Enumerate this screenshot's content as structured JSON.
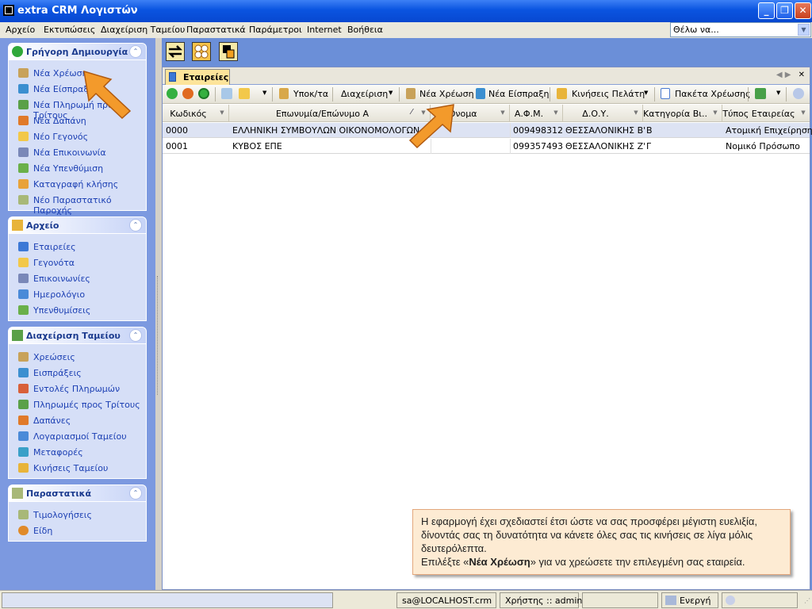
{
  "window": {
    "title": "extra CRM Λογιστών"
  },
  "menu": [
    "Αρχείο",
    "Εκτυπώσεις",
    "Διαχείριση Ταμείου",
    "Παραστατικά",
    "Παράμετροι",
    "Internet",
    "Βοήθεια"
  ],
  "search": {
    "value": "Θέλω να..."
  },
  "sidebar": {
    "quick": {
      "title": "Γρήγορη Δημιουργία",
      "items": [
        "Νέα Χρέωση",
        "Νέα Είσπραξη",
        "Νέα Πληρωμή προς Τρίτους",
        "Νέα Δαπάνη",
        "Νέο Γεγονός",
        "Νέα Επικοινωνία",
        "Νέα Υπενθύμιση",
        "Καταγραφή κλήσης",
        "Νέο Παραστατικό Παροχής"
      ]
    },
    "archive": {
      "title": "Αρχείο",
      "items": [
        "Εταιρείες",
        "Γεγονότα",
        "Επικοινωνίες",
        "Ημερολόγιο",
        "Υπενθυμίσεις"
      ]
    },
    "cash": {
      "title": "Διαχείριση Ταμείου",
      "items": [
        "Χρεώσεις",
        "Εισπράξεις",
        "Εντολές Πληρωμών",
        "Πληρωμές προς Τρίτους",
        "Δαπάνες",
        "Λογαριασμοί Ταμείου",
        "Μεταφορές",
        "Κινήσεις Ταμείου"
      ]
    },
    "docs": {
      "title": "Παραστατικά",
      "items": [
        "Τιμολογήσεις",
        "Είδη"
      ]
    }
  },
  "tab": {
    "label": "Εταιρείες"
  },
  "toolbar": {
    "subcat": "Υποκ/τα",
    "manage": "Διαχείριση",
    "new_charge": "Νέα Χρέωση",
    "new_receipt": "Νέα Είσπραξη",
    "moves": "Κινήσεις Πελάτη",
    "packages": "Πακέτα Χρέωσης"
  },
  "grid": {
    "columns": [
      "Κωδικός",
      "Επωνυμία/Επώνυμο Α",
      "Όνομα",
      "Α.Φ.Μ.",
      "Δ.Ο.Υ.",
      "Κατηγορία Βι...",
      "Τύπος Εταιρείας"
    ],
    "rows": [
      [
        "0000",
        "ΕΛΛΗΝΙΚΗ ΣΥΜΒΟΥΛΩΝ ΟΙΚΟΝΟΜΟΛΟΓΩΝ ΑΕ",
        "",
        "009498312",
        "ΘΕΣΣΑΛΟΝΙΚΗΣ Β'",
        "Β",
        "Ατομική Επιχείρηση"
      ],
      [
        "0001",
        "ΚΥΒΟΣ ΕΠΕ",
        "",
        "099357493",
        "ΘΕΣΣΑΛΟΝΙΚΗΣ Ζ'",
        "Γ",
        "Νομικό Πρόσωπο"
      ]
    ]
  },
  "tip": {
    "line1": "Η εφαρμογή έχει σχεδιαστεί έτσι ώστε να σας προσφέρει μέγιστη ευελιξία, δίνοντάς σας τη δυνατότητα να κάνετε όλες σας τις κινήσεις σε λίγα μόλις δευτερόλεπτα.",
    "pre": "Επιλέξτε «",
    "bold": "Νέα Χρέωση",
    "post": "» για να χρεώσετε την επιλεγμένη σας εταιρεία."
  },
  "status": {
    "server": "sa@LOCALHOST.crm",
    "user": "Χρήστης :: admin",
    "state": "Ενεργή"
  },
  "colors": {
    "titlebar": "#0a54e0",
    "sidebar": "#7c99e0",
    "link": "#1b3fb3",
    "tip_bg": "#fdebd3",
    "arrow": "#f39a2b"
  }
}
